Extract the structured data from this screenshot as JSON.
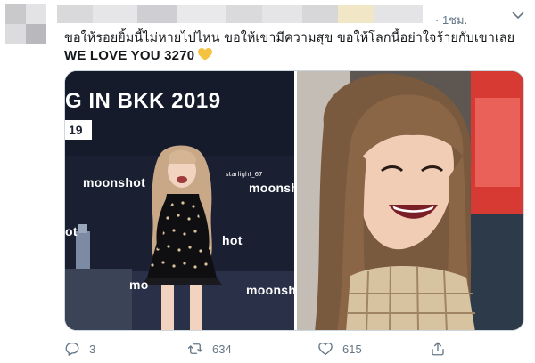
{
  "tweet": {
    "timestamp": "· 1ชม.",
    "text_line1": "ขอให้รอยยิ้มนี้ไม่หายไปไหน ขอให้เขามีความสุข ขอให้โลกนี้อย่าใจร้ายกับเขาเลย",
    "text_line2": "WE LOVE YOU 3270",
    "heart_color": "#f5c342"
  },
  "media": {
    "left_photo": {
      "banner_title": "G IN BKK 2019",
      "banner_date": "19",
      "sponsor_texts": [
        "moonshot",
        "moonsh",
        "ot",
        "hot",
        "mo",
        "moonsh"
      ],
      "photo_credit": "starlight_67"
    }
  },
  "actions": {
    "reply_count": "3",
    "retweet_count": "634",
    "like_count": "615"
  },
  "colors": {
    "text": "#14171a",
    "muted": "#657786",
    "border": "#ccd6dd"
  }
}
